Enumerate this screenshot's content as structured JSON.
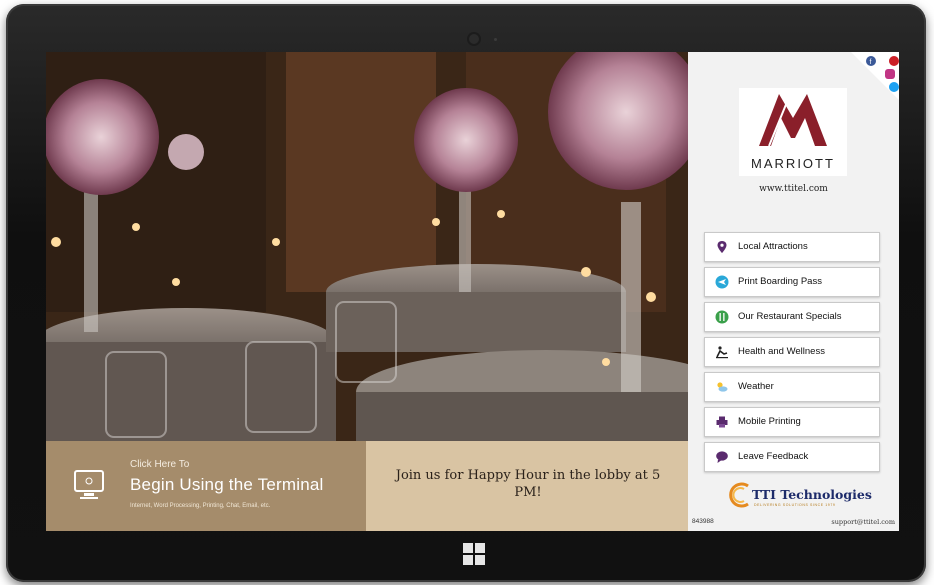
{
  "terminal": {
    "click_here": "Click Here To",
    "begin_label": "Begin Using the Terminal",
    "services": "Internet, Word Processing, Printing, Chat, Email, etc."
  },
  "promo": {
    "message": "Join us for Happy Hour in the lobby at 5 PM!"
  },
  "brand": {
    "logo_text": "MARRIOTT",
    "website": "www.ttitel.com",
    "color": "#8a1f2a"
  },
  "social_icons": [
    "facebook-icon",
    "pinterest-icon",
    "instagram-icon",
    "twitter-icon"
  ],
  "menu": {
    "items": [
      {
        "label": "Local Attractions",
        "icon": "map-pin-icon"
      },
      {
        "label": "Print Boarding Pass",
        "icon": "airplane-icon"
      },
      {
        "label": "Our Restaurant Specials",
        "icon": "fork-knife-icon"
      },
      {
        "label": "Health and Wellness",
        "icon": "fitness-icon"
      },
      {
        "label": "Weather",
        "icon": "weather-icon"
      },
      {
        "label": "Mobile Printing",
        "icon": "printer-icon"
      },
      {
        "label": "Leave Feedback",
        "icon": "chat-bubble-icon"
      }
    ]
  },
  "footer": {
    "provider_name": "TTI Technologies",
    "provider_tagline": "DELIVERING SOLUTIONS SINCE 1979",
    "terminal_id": "843988",
    "support_email": "support@ttitel.com"
  }
}
